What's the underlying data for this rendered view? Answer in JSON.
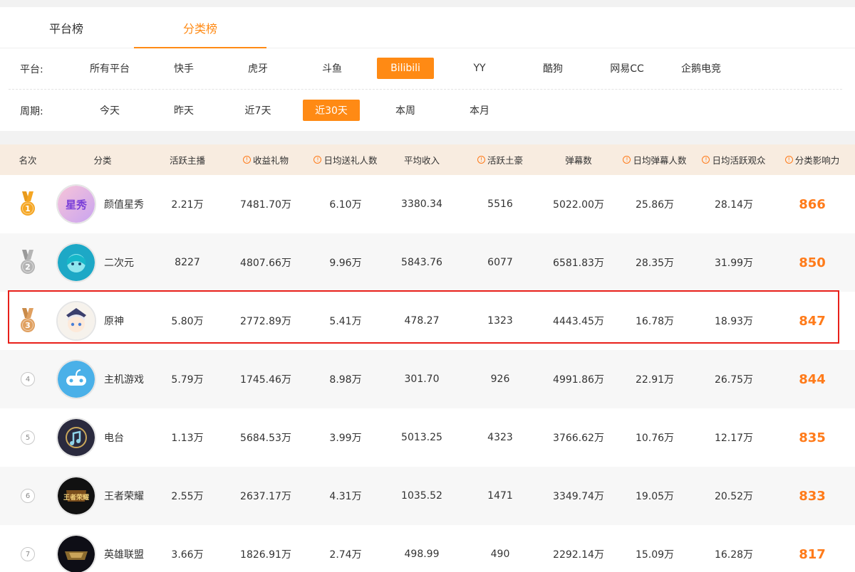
{
  "tabs": [
    {
      "label": "平台榜",
      "active": false
    },
    {
      "label": "分类榜",
      "active": true
    }
  ],
  "platform_filter": {
    "label": "平台:",
    "options": [
      "所有平台",
      "快手",
      "虎牙",
      "斗鱼",
      "Bilibili",
      "YY",
      "酷狗",
      "网易CC",
      "企鹅电竞"
    ],
    "selected": "Bilibili"
  },
  "period_filter": {
    "label": "周期:",
    "options": [
      "今天",
      "昨天",
      "近7天",
      "近30天",
      "本周",
      "本月"
    ],
    "selected": "近30天"
  },
  "table": {
    "headers": [
      "名次",
      "分类",
      "活跃主播",
      "收益礼物",
      "日均送礼人数",
      "平均收入",
      "活跃土豪",
      "弹幕数",
      "日均弹幕人数",
      "日均活跃观众",
      "分类影响力"
    ],
    "header_info": [
      false,
      false,
      false,
      true,
      true,
      false,
      true,
      false,
      true,
      true,
      true
    ],
    "rows": [
      {
        "rank": "1",
        "name": "颜值星秀",
        "avatar_text": "星秀",
        "active_anchors": "2.21万",
        "gift_income": "7481.70万",
        "daily_givers": "6.10万",
        "avg_income": "3380.34",
        "active_rich": "5516",
        "danmaku": "5022.00万",
        "daily_danmaku_users": "25.86万",
        "daily_active_viewers": "28.14万",
        "influence": "866"
      },
      {
        "rank": "2",
        "name": "二次元",
        "avatar_text": "",
        "active_anchors": "8227",
        "gift_income": "4807.66万",
        "daily_givers": "9.96万",
        "avg_income": "5843.76",
        "active_rich": "6077",
        "danmaku": "6581.83万",
        "daily_danmaku_users": "28.35万",
        "daily_active_viewers": "31.99万",
        "influence": "850"
      },
      {
        "rank": "3",
        "name": "原神",
        "avatar_text": "",
        "active_anchors": "5.80万",
        "gift_income": "2772.89万",
        "daily_givers": "5.41万",
        "avg_income": "478.27",
        "active_rich": "1323",
        "danmaku": "4443.45万",
        "daily_danmaku_users": "16.78万",
        "daily_active_viewers": "18.93万",
        "influence": "847"
      },
      {
        "rank": "4",
        "name": "主机游戏",
        "avatar_text": "",
        "active_anchors": "5.79万",
        "gift_income": "1745.46万",
        "daily_givers": "8.98万",
        "avg_income": "301.70",
        "active_rich": "926",
        "danmaku": "4991.86万",
        "daily_danmaku_users": "22.91万",
        "daily_active_viewers": "26.75万",
        "influence": "844"
      },
      {
        "rank": "5",
        "name": "电台",
        "avatar_text": "",
        "active_anchors": "1.13万",
        "gift_income": "5684.53万",
        "daily_givers": "3.99万",
        "avg_income": "5013.25",
        "active_rich": "4323",
        "danmaku": "3766.62万",
        "daily_danmaku_users": "10.76万",
        "daily_active_viewers": "12.17万",
        "influence": "835"
      },
      {
        "rank": "6",
        "name": "王者荣耀",
        "avatar_text": "王者荣耀",
        "active_anchors": "2.55万",
        "gift_income": "2637.17万",
        "daily_givers": "4.31万",
        "avg_income": "1035.52",
        "active_rich": "1471",
        "danmaku": "3349.74万",
        "daily_danmaku_users": "19.05万",
        "daily_active_viewers": "20.52万",
        "influence": "833"
      },
      {
        "rank": "7",
        "name": "英雄联盟",
        "avatar_text": "",
        "active_anchors": "3.66万",
        "gift_income": "1826.91万",
        "daily_givers": "2.74万",
        "avg_income": "498.99",
        "active_rich": "490",
        "danmaku": "2292.14万",
        "daily_danmaku_users": "15.09万",
        "daily_active_viewers": "16.28万",
        "influence": "817"
      }
    ]
  },
  "colors": {
    "accent": "#ff8a14",
    "highlight_border": "#e8201a",
    "header_bg": "#f8ece0",
    "medal_gold": "#f5a623",
    "medal_silver": "#b5b5b5",
    "medal_bronze": "#e0a060"
  }
}
